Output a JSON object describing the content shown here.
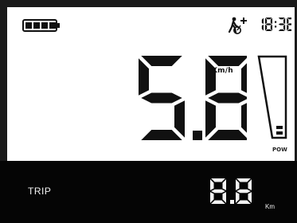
{
  "status_bar": {
    "battery": {
      "icon": "battery-icon",
      "level_bars": 4,
      "max_bars": 4
    },
    "walk_assist_icon": "walk-assist-icon",
    "time": "18:38"
  },
  "speed": {
    "value": "5.8",
    "unit": "Km/h"
  },
  "power": {
    "label": "POW",
    "level_fraction": 0.12
  },
  "trip": {
    "label": "TRIP",
    "value": "8.8",
    "unit": "Km"
  },
  "colors": {
    "segment": "#111111",
    "background": "#ffffff",
    "bottom_bar": "#050505",
    "bottom_text": "#f2f2f2"
  }
}
